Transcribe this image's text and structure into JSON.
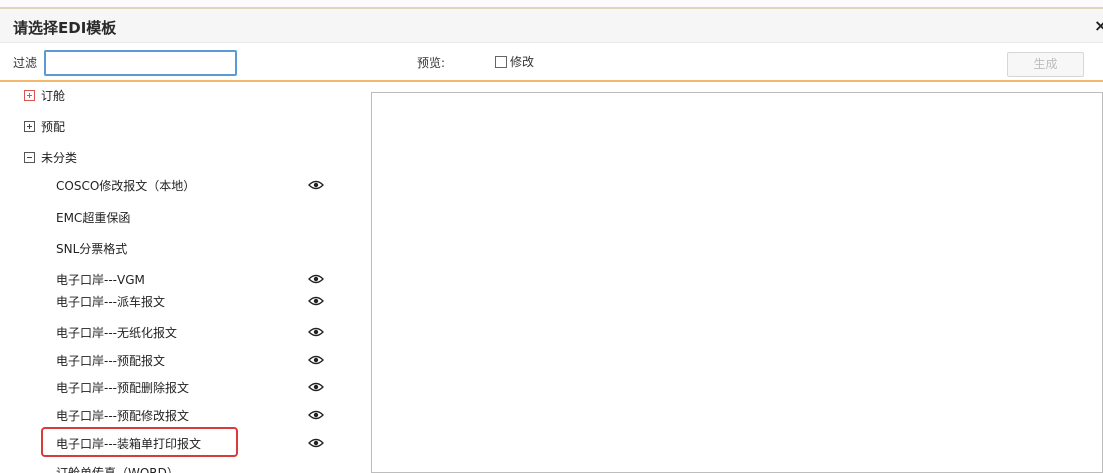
{
  "dialog": {
    "title": "请选择EDI模板",
    "close_glyph": "×"
  },
  "toolbar": {
    "filter_label": "过滤",
    "filter_value": "",
    "preview_label": "预览:",
    "modify_label": "修改",
    "modify_checked": false,
    "generate_label": "生成"
  },
  "tree": {
    "groups": [
      {
        "label": "订舱",
        "state": "collapsed",
        "color": "#d9534f"
      },
      {
        "label": "预配",
        "state": "collapsed"
      },
      {
        "label": "未分类",
        "state": "expanded"
      }
    ],
    "items": [
      {
        "label": "COSCO修改报文（本地）",
        "eye": true
      },
      {
        "label": "EMC超重保函",
        "eye": false
      },
      {
        "label": "SNL分票格式",
        "eye": false
      },
      {
        "label": "电子口岸---VGM",
        "eye": true
      },
      {
        "label": "电子口岸---派车报文",
        "eye": true
      },
      {
        "label": "电子口岸---无纸化报文",
        "eye": true
      },
      {
        "label": "电子口岸---预配报文",
        "eye": true
      },
      {
        "label": "电子口岸---预配删除报文",
        "eye": true
      },
      {
        "label": "电子口岸---预配修改报文",
        "eye": true
      },
      {
        "label": "电子口岸---装箱单打印报文",
        "eye": true,
        "highlighted": true
      },
      {
        "label": "订舱单传真（WORD）",
        "eye": false
      }
    ],
    "icon": "eye-icon"
  },
  "colors": {
    "accent_border": "#f2b96a",
    "focus_blue": "#5b9bd5",
    "highlight_red": "#d93b3b"
  }
}
